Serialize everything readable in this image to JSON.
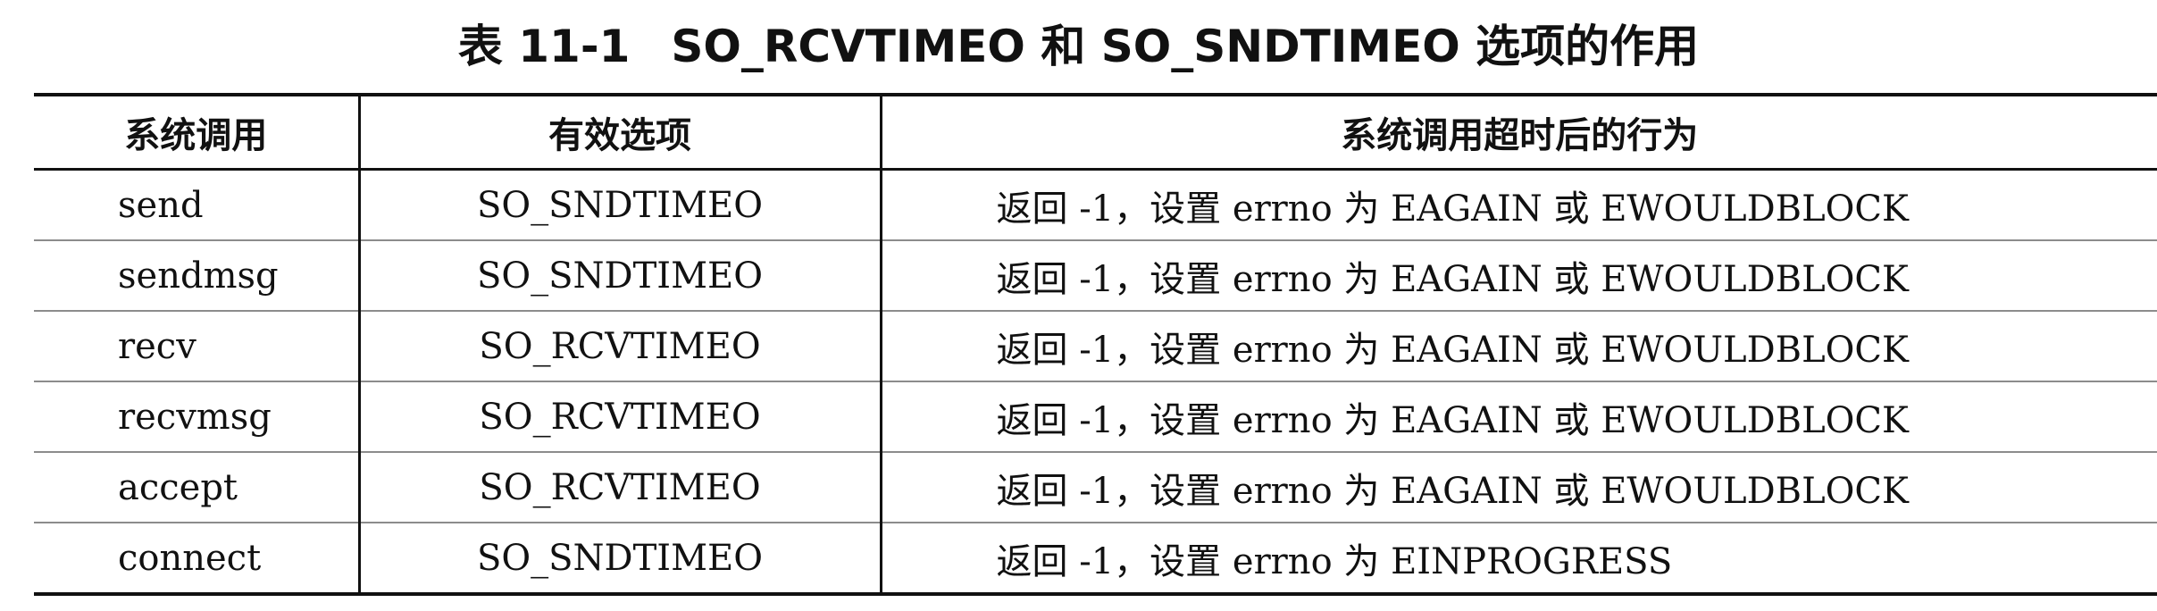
{
  "caption": {
    "number": "表 11-1",
    "title": "SO_RCVTIMEO 和 SO_SNDTIMEO 选项的作用"
  },
  "table": {
    "headers": [
      "系统调用",
      "有效选项",
      "系统调用超时后的行为"
    ],
    "rows": [
      [
        "send",
        "SO_SNDTIMEO",
        "返回 -1，设置 errno 为 EAGAIN 或 EWOULDBLOCK"
      ],
      [
        "sendmsg",
        "SO_SNDTIMEO",
        "返回 -1，设置 errno 为 EAGAIN 或 EWOULDBLOCK"
      ],
      [
        "recv",
        "SO_RCVTIMEO",
        "返回 -1，设置 errno 为 EAGAIN 或 EWOULDBLOCK"
      ],
      [
        "recvmsg",
        "SO_RCVTIMEO",
        "返回 -1，设置 errno 为 EAGAIN 或 EWOULDBLOCK"
      ],
      [
        "accept",
        "SO_RCVTIMEO",
        "返回 -1，设置 errno 为 EAGAIN 或 EWOULDBLOCK"
      ],
      [
        "connect",
        "SO_SNDTIMEO",
        "返回 -1，设置 errno 为 EINPROGRESS"
      ]
    ]
  }
}
